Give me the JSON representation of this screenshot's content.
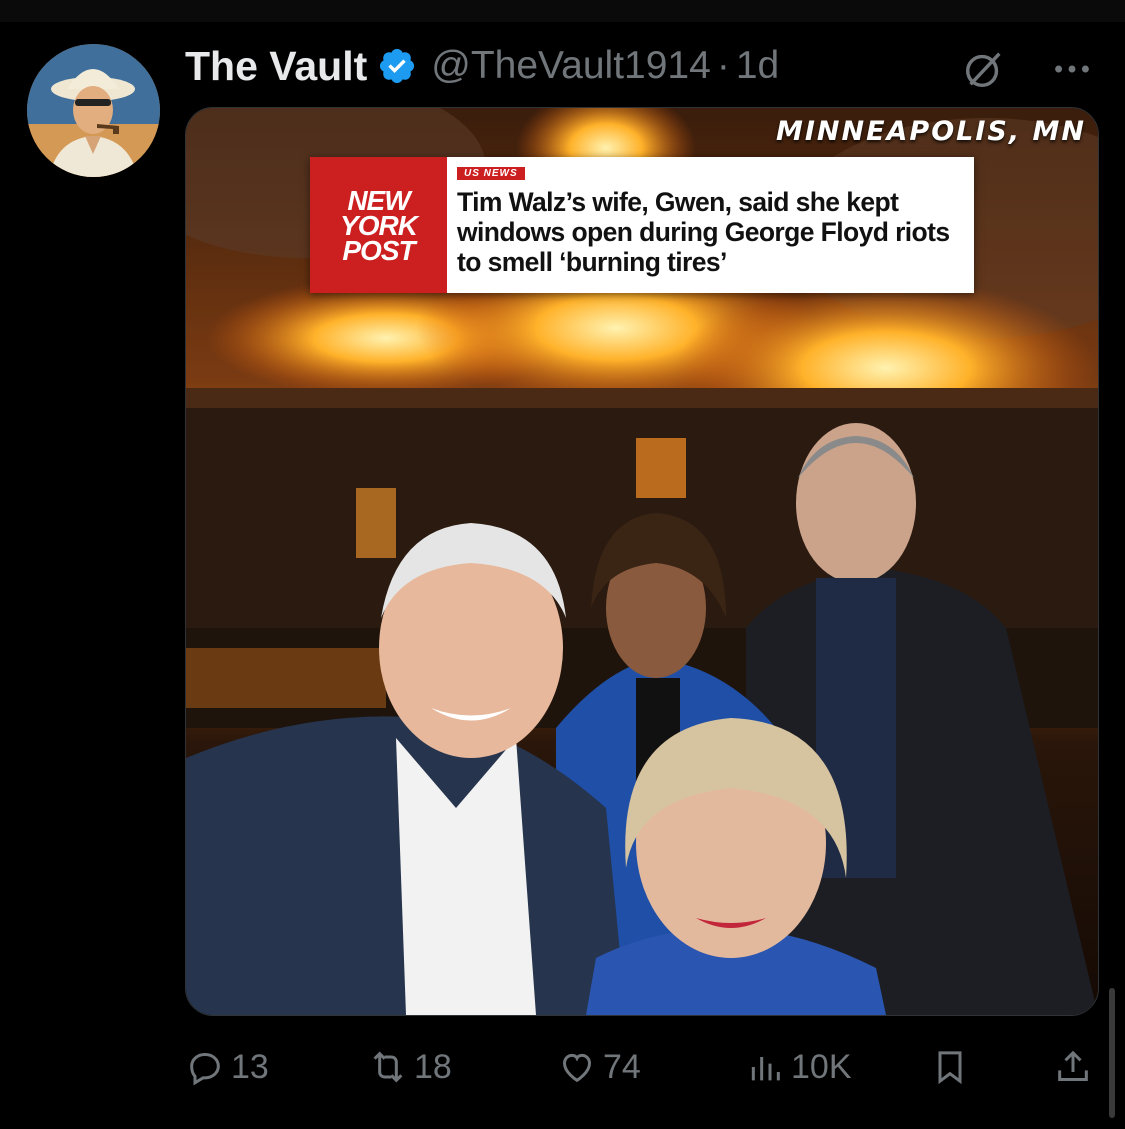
{
  "author": {
    "display_name": "The Vault",
    "handle": "@TheVault1914",
    "separator": "·",
    "timestamp": "1d",
    "verified": true
  },
  "media": {
    "location_caption": "MINNEAPOLIS, MN",
    "news_card": {
      "logo_lines": [
        "NEW",
        "YORK",
        "POST"
      ],
      "tag": "US NEWS",
      "headline": "Tim Walz’s wife, Gwen, said she kept windows open during George Floyd riots to smell ‘burning tires’"
    }
  },
  "actions": {
    "reply_count": "13",
    "repost_count": "18",
    "like_count": "74",
    "views_count": "10K"
  },
  "icons": {
    "verified": "verified-badge-icon",
    "grok": "grok-icon",
    "more": "more-icon",
    "reply": "reply-icon",
    "repost": "repost-icon",
    "like": "heart-icon",
    "views": "views-icon",
    "bookmark": "bookmark-icon",
    "share": "share-icon"
  },
  "colors": {
    "background": "#000000",
    "text_primary": "#e7e9ea",
    "text_secondary": "#71767b",
    "verified_blue": "#1d9bf0",
    "nyp_red": "#cc1f1f"
  }
}
